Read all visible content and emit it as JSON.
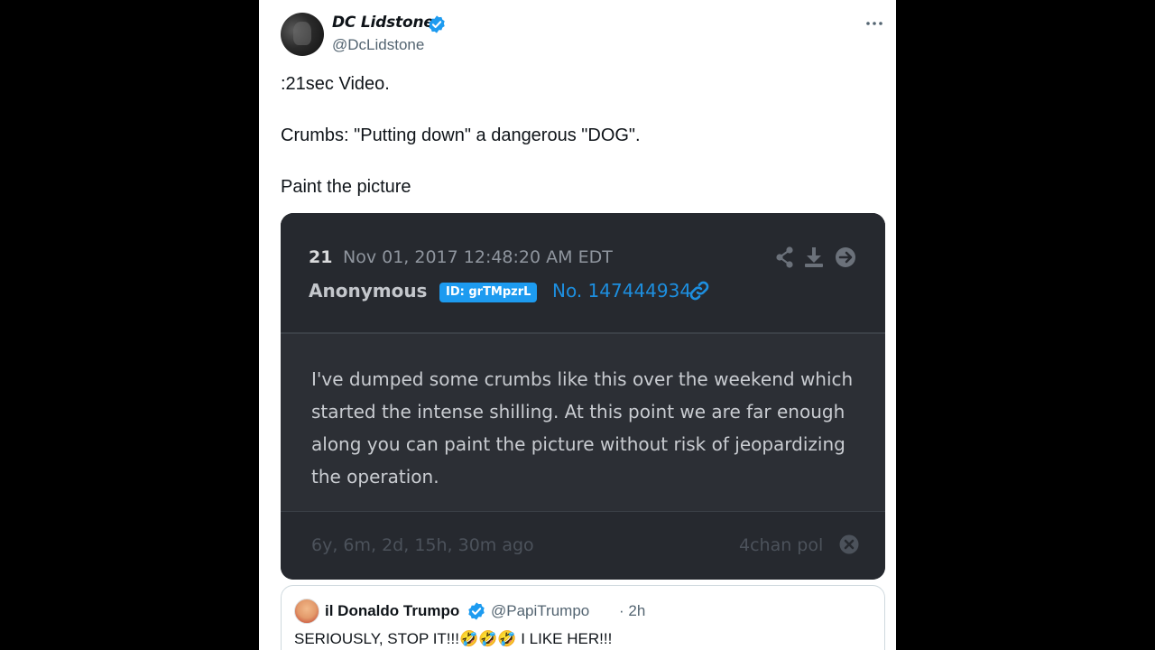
{
  "tweet": {
    "display_name": "DC Lidstone",
    "handle": "@DcLidstone",
    "lines": [
      ":21sec Video.",
      "Crumbs: \"Putting down\" a dangerous \"DOG\".",
      "Paint the picture"
    ],
    "icons": {
      "verified": "verified-badge-icon",
      "more": "more-options-icon"
    }
  },
  "card": {
    "post_number": "21",
    "date": "Nov 01, 2017 12:48:20 AM EDT",
    "author": "Anonymous",
    "id_badge": "ID: grTMpzrL",
    "post_no": "No. 147444934",
    "body": "I've dumped some crumbs like this over the weekend which started the intense shilling. At this point we are far enough along you can paint the picture without risk of jeopardizing the operation.",
    "age": "6y, 6m, 2d, 15h, 30m ago",
    "source": "4chan pol",
    "icons": [
      "share-icon",
      "download-icon",
      "forward-icon",
      "link-icon",
      "close-icon"
    ]
  },
  "quote": {
    "display_name": "il Donaldo Trumpo",
    "handle": "@PapiTrumpo",
    "time": "· 2h",
    "text_before": "SERIOUSLY, STOP IT!!!",
    "emoji": "🤣🤣🤣",
    "text_after": " I LIKE HER!!!"
  },
  "colors": {
    "brand_blue": "#1d9bf0",
    "card_bg": "#26292f",
    "card_body_bg": "#2c2f35"
  }
}
